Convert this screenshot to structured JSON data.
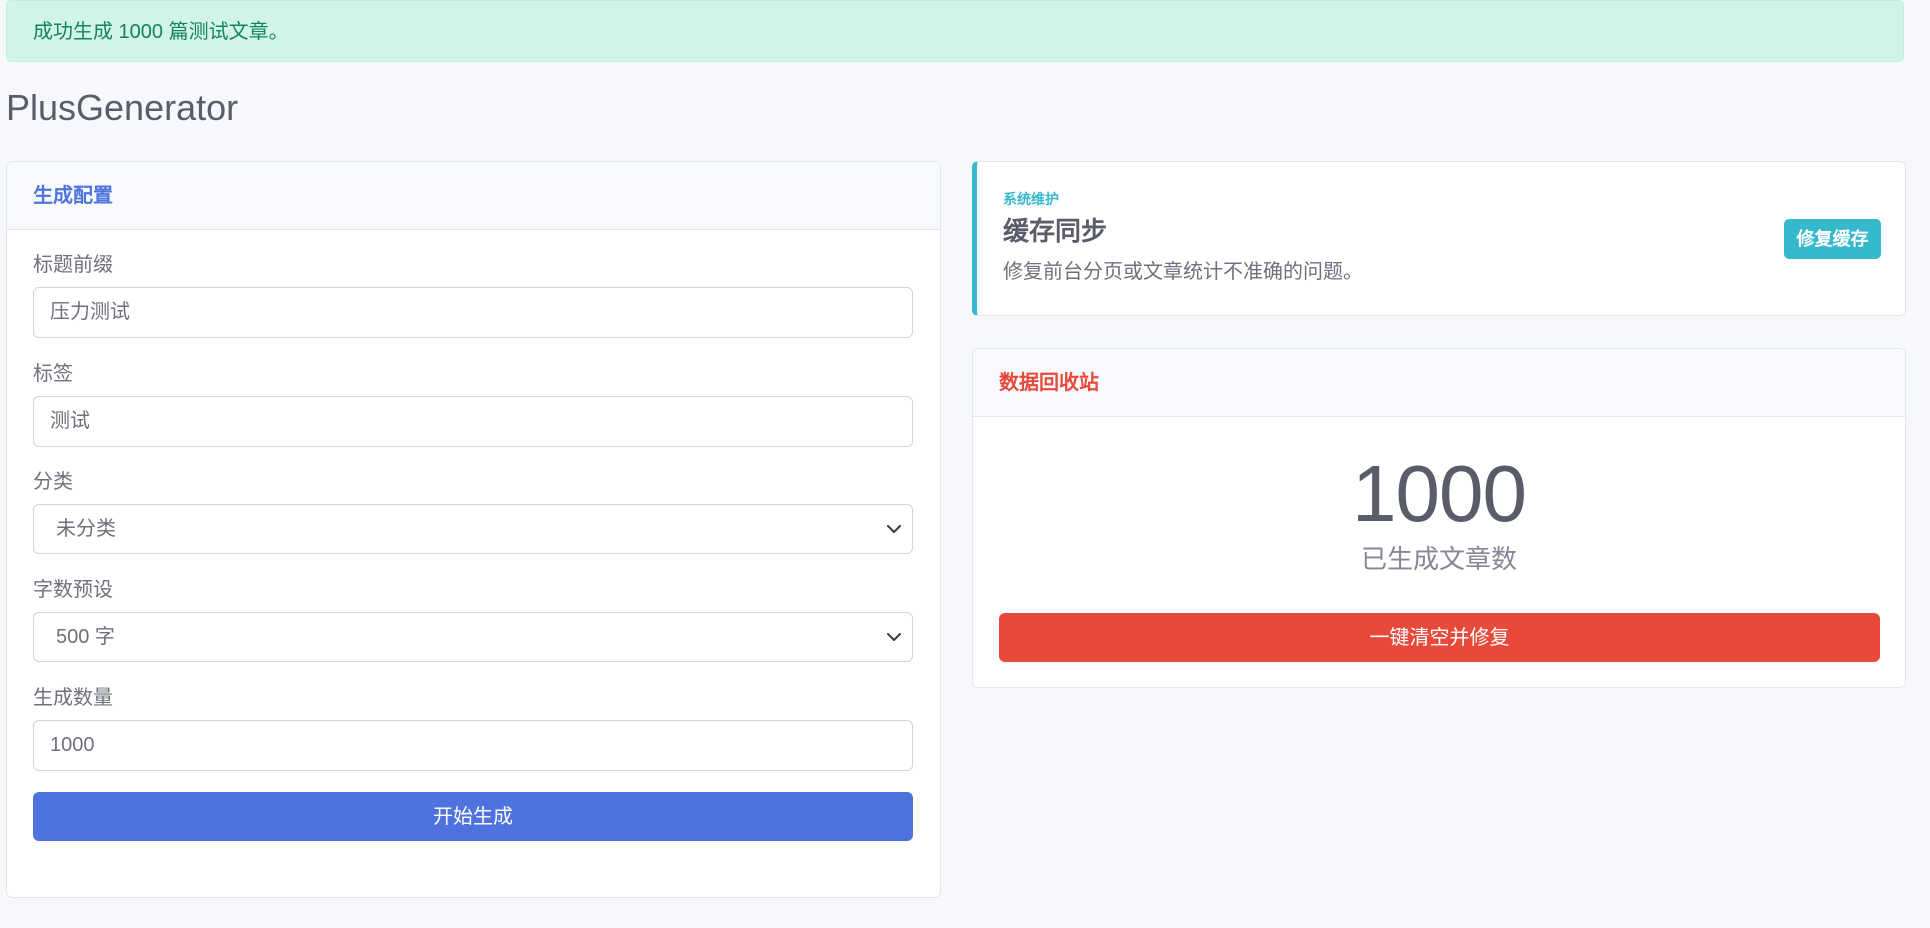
{
  "alert": {
    "message": "成功生成 1000 篇测试文章。"
  },
  "page": {
    "title": "PlusGenerator"
  },
  "generate_card": {
    "header": "生成配置",
    "title_prefix": {
      "label": "标题前缀",
      "value": "压力测试"
    },
    "tags": {
      "label": "标签",
      "value": "测试"
    },
    "category": {
      "label": "分类",
      "selected": "未分类"
    },
    "word_preset": {
      "label": "字数预设",
      "selected": "500 字"
    },
    "count": {
      "label": "生成数量",
      "value": "1000"
    },
    "submit_label": "开始生成",
    "accent_color": "#4e73df"
  },
  "cache_card": {
    "kicker": "系统维护",
    "title": "缓存同步",
    "description": "修复前台分页或文章统计不准确的问题。",
    "button_label": "修复缓存",
    "accent_color": "#36b9cc"
  },
  "recycle_card": {
    "header": "数据回收站",
    "stat_value": "1000",
    "stat_caption": "已生成文章数",
    "button_label": "一键清空并修复",
    "accent_color": "#e74a3b"
  },
  "icons": {
    "select_arrow": "chevron-down-icon"
  }
}
